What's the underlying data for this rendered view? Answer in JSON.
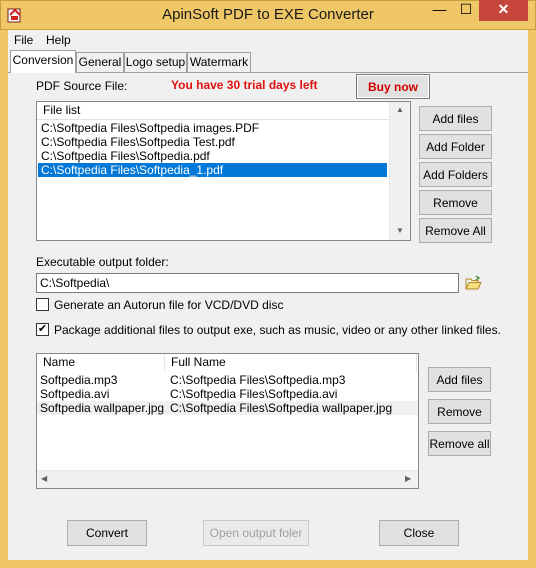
{
  "window": {
    "title": "ApinSoft PDF to EXE Converter",
    "min_glyph": "—",
    "max_glyph": "☐",
    "close_glyph": "✕"
  },
  "menu": {
    "file": "File",
    "help": "Help"
  },
  "tabs": [
    "Conversion",
    "General",
    "Logo setup",
    "Watermark"
  ],
  "source": {
    "label": "PDF Source File:",
    "trial_notice": "You have 30 trial days left",
    "buy_now": "Buy now",
    "list_header": "File list",
    "files": [
      "C:\\Softpedia Files\\Softpedia images.PDF",
      "C:\\Softpedia Files\\Softpedia Test.pdf",
      "C:\\Softpedia Files\\Softpedia.pdf",
      "C:\\Softpedia Files\\Softpedia_1.pdf"
    ],
    "selected_index": 3,
    "buttons": {
      "add_files": "Add files",
      "add_folder": "Add Folder",
      "add_folders": "Add Folders",
      "remove": "Remove",
      "remove_all": "Remove All"
    }
  },
  "output": {
    "label": "Executable output folder:",
    "value": "C:\\Softpedia\\"
  },
  "options": {
    "autorun_label": "Generate an Autorun file for VCD/DVD disc",
    "autorun_checked": false,
    "package_label": "Package additional files to output exe, such as music, video or any other linked files.",
    "package_checked": true
  },
  "additional": {
    "columns": [
      "Name",
      "Full Name"
    ],
    "rows": [
      {
        "name": "Softpedia.mp3",
        "full": "C:\\Softpedia Files\\Softpedia.mp3"
      },
      {
        "name": "Softpedia.avi",
        "full": "C:\\Softpedia Files\\Softpedia.avi"
      },
      {
        "name": "Softpedia wallpaper.jpg",
        "full": "C:\\Softpedia Files\\Softpedia wallpaper.jpg"
      }
    ],
    "buttons": {
      "add_files": "Add files",
      "remove": "Remove",
      "remove_all": "Remove all"
    }
  },
  "footer": {
    "convert": "Convert",
    "open_output": "Open output foler",
    "close": "Close"
  },
  "icons": {
    "app": "pdf-app-icon",
    "folder": "folder-open-icon"
  }
}
